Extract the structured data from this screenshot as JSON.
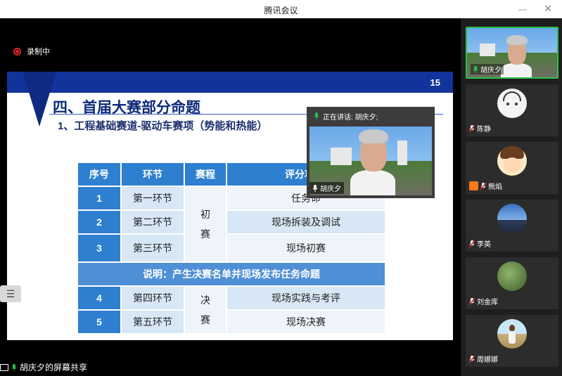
{
  "window": {
    "title": "腾讯会议"
  },
  "recording": {
    "label": "录制中"
  },
  "slide": {
    "page": "15",
    "heading": "四、首届大赛部分命题",
    "subheading": "1、工程基础赛道-驱动车赛项（势能和热能）",
    "table": {
      "headers": [
        "序号",
        "环节",
        "赛程",
        "评分项目/"
      ],
      "rows": [
        {
          "num": "1",
          "stage": "第一环节",
          "item": "任务命"
        },
        {
          "num": "2",
          "stage": "第二环节",
          "item": "现场拆装及调试"
        },
        {
          "num": "3",
          "stage": "第三环节",
          "item": "现场初赛"
        },
        {
          "num": "4",
          "stage": "第四环节",
          "item": "现场实践与考评"
        },
        {
          "num": "5",
          "stage": "第五环节",
          "item": "现场决赛"
        }
      ],
      "phase1": [
        "初",
        "赛"
      ],
      "phase2": [
        "决",
        "赛"
      ],
      "note": "说明：产生决赛名单并现场发布任务命题"
    }
  },
  "speaker": {
    "status": "正在讲话: 胡庆夕;",
    "name": "胡庆夕"
  },
  "share": {
    "label": "胡庆夕的屏幕共享"
  },
  "participants": [
    {
      "name": "胡庆夕"
    },
    {
      "name": "陈静"
    },
    {
      "name": "熊焰"
    },
    {
      "name": "李英"
    },
    {
      "name": "刘金库"
    },
    {
      "name": "周娜娜"
    }
  ],
  "colors": {
    "accent_green": "#2bc14c",
    "slide_blue": "#12339b",
    "table_blue": "#2e7fd0"
  }
}
